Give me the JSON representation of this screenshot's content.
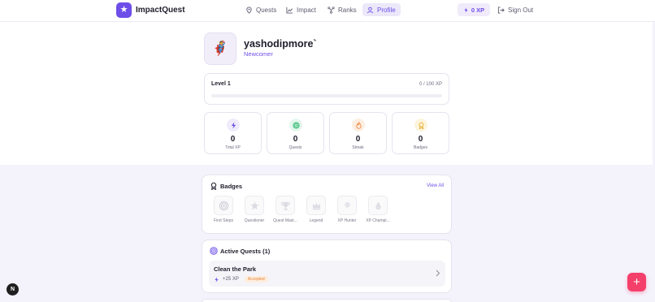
{
  "app": {
    "name": "ImpactQuest"
  },
  "nav": {
    "items": [
      {
        "label": "Quests",
        "icon": "map-pin-icon"
      },
      {
        "label": "Impact",
        "icon": "chart-icon"
      },
      {
        "label": "Ranks",
        "icon": "trophy-nodes-icon"
      },
      {
        "label": "Profile",
        "icon": "user-icon",
        "active": true
      }
    ],
    "xp": "0 XP",
    "signout": "Sign Out"
  },
  "profile": {
    "username": "yashodipmore`",
    "rank_title": "Newcomer",
    "avatar_emoji": "🦸"
  },
  "level": {
    "label": "Level 1",
    "progress_text": "0 / 100 XP",
    "progress_fraction": 0
  },
  "stats": [
    {
      "value": "0",
      "label": "Total XP",
      "icon": "bolt-icon",
      "color": "#6d4ee8",
      "bg": "#efebfb"
    },
    {
      "value": "0",
      "label": "Quests",
      "icon": "target-icon",
      "color": "#1fb566",
      "bg": "#e5f7ee"
    },
    {
      "value": "0",
      "label": "Streak",
      "icon": "flame-icon",
      "color": "#ef7a2c",
      "bg": "#fdeee2"
    },
    {
      "value": "0",
      "label": "Badges",
      "icon": "award-icon",
      "color": "#e5a419",
      "bg": "#fdf4dc"
    }
  ],
  "badges": {
    "title": "Badges",
    "view_all": "View All",
    "items": [
      {
        "label": "First Steps",
        "icon": "target-badge-icon"
      },
      {
        "label": "Questioner",
        "icon": "star-badge-icon"
      },
      {
        "label": "Quest Mast...",
        "icon": "trophy-badge-icon"
      },
      {
        "label": "Legend",
        "icon": "crown-badge-icon"
      },
      {
        "label": "XP Hunter",
        "icon": "diamond-badge-icon"
      },
      {
        "label": "XP Champi...",
        "icon": "moneybag-badge-icon"
      }
    ]
  },
  "active_quests": {
    "title": "Active Quests (1)",
    "items": [
      {
        "name": "Clean the Park",
        "xp": "+25 XP",
        "status": "Accepted"
      }
    ]
  },
  "fab": {
    "label": "+"
  },
  "dev_badge": {
    "label": "N"
  }
}
